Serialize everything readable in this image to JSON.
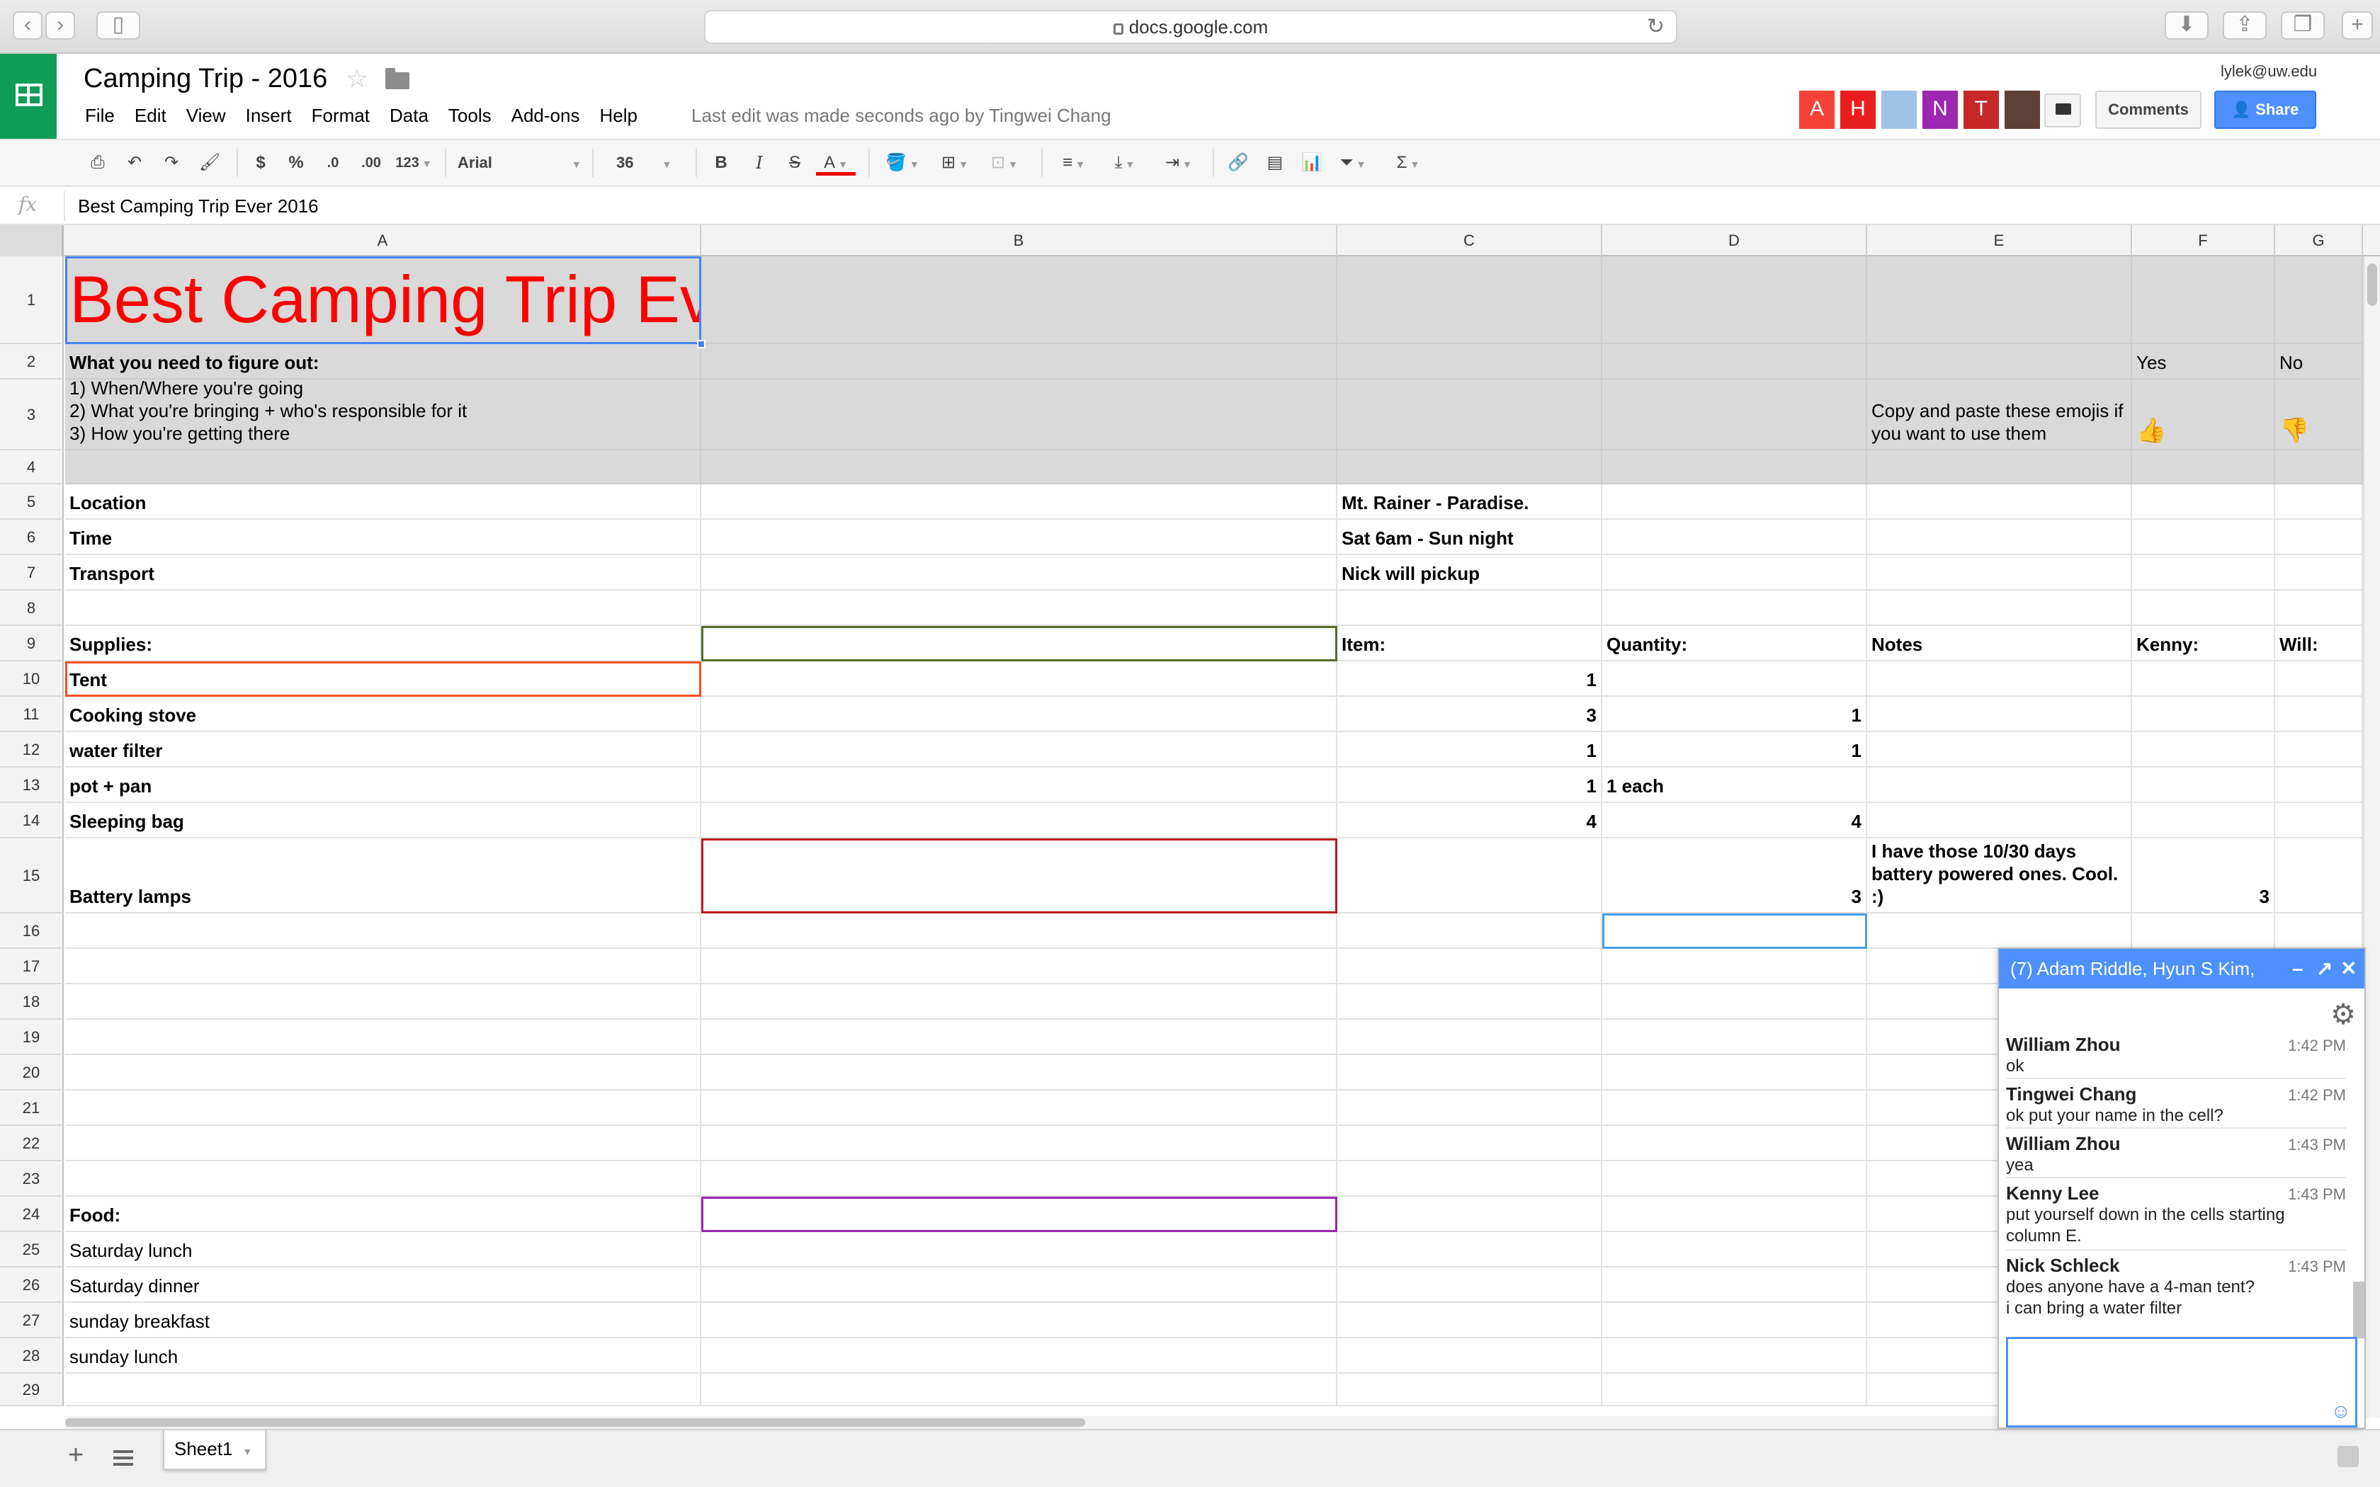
{
  "browser": {
    "url": "docs.google.com"
  },
  "doc": {
    "title": "Camping Trip - 2016",
    "menus": [
      "File",
      "Edit",
      "View",
      "Insert",
      "Format",
      "Data",
      "Tools",
      "Add-ons",
      "Help"
    ],
    "last_edit": "Last edit was made seconds ago by Tingwei Chang",
    "user_email": "lylek@uw.edu",
    "collaborators": [
      {
        "letter": "A",
        "color": "#f44336"
      },
      {
        "letter": "H",
        "color": "#e91e1e"
      },
      {
        "letter": "",
        "color": "#9ec3e6"
      },
      {
        "letter": "N",
        "color": "#9c27b0"
      },
      {
        "letter": "T",
        "color": "#c62828"
      },
      {
        "letter": "",
        "color": "#5d4037"
      }
    ],
    "comments_label": "Comments",
    "share_label": "Share"
  },
  "toolbar": {
    "currency": "$",
    "percent": "%",
    "dec_less": ".0",
    "dec_more": ".00",
    "format": "123",
    "font": "Arial",
    "size": "36",
    "bold": "B",
    "italic": "I",
    "strike": "S",
    "text_color": "A",
    "sum": "Σ"
  },
  "formula": {
    "fx": "fx",
    "value": "Best Camping Trip Ever 2016"
  },
  "columns": [
    "A",
    "B",
    "C",
    "D",
    "E",
    "F",
    "G"
  ],
  "rows": [
    "1",
    "2",
    "3",
    "4",
    "5",
    "6",
    "7",
    "8",
    "9",
    "10",
    "11",
    "12",
    "13",
    "14",
    "15",
    "16",
    "17",
    "18",
    "19",
    "20",
    "21",
    "22",
    "23",
    "24",
    "25",
    "26",
    "27",
    "28",
    "29"
  ],
  "cells": {
    "A1": "Best Camping Trip Ever 2016",
    "A2": "What you need to figure out:",
    "F2": "Yes",
    "G2": "No",
    "A3": "1) When/Where you're going\n2) What you're bringing + who's responsible for it\n3) How you're getting there",
    "E3": "Copy and paste these emojis if\nyou want to use them",
    "F3": "👍",
    "G3": "👎",
    "A5": "Location",
    "C5": "Mt. Rainer - Paradise.",
    "A6": "Time",
    "C6": "Sat 6am - Sun night",
    "A7": "Transport",
    "C7": "Nick will pickup",
    "A9": "Supplies:",
    "C9": "Item:",
    "D9": "Quantity:",
    "E9": "Notes",
    "F9": "Kenny:",
    "G9": "Will:",
    "A10": "Tent",
    "C10": "1",
    "A11": "Cooking stove",
    "C11": "3",
    "D11": "1",
    "A12": "water filter",
    "C12": "1",
    "D12": "1",
    "A13": "pot + pan",
    "C13": "1",
    "D13": "1 each",
    "A14": "Sleeping bag",
    "C14": "4",
    "D14": "4",
    "A15": "Battery lamps",
    "D15": "3",
    "E15": "I have those 10/30 days\nbattery powered ones.  Cool.\n:)",
    "F15": "3",
    "A24": "Food:",
    "A25": "Saturday lunch",
    "A26": "Saturday dinner",
    "A27": "sunday breakfast",
    "A28": "sunday lunch"
  },
  "sheet_tab": "Sheet1",
  "chat": {
    "title": "(7) Adam Riddle, Hyun S Kim,",
    "messages": [
      {
        "who": "William Zhou",
        "time": "1:42 PM",
        "text": "ok"
      },
      {
        "who": "Tingwei Chang",
        "time": "1:42 PM",
        "text": "ok put your name in the cell?"
      },
      {
        "who": "William Zhou",
        "time": "1:43 PM",
        "text": "yea"
      },
      {
        "who": "Kenny Lee",
        "time": "1:43 PM",
        "text": "put yourself down in the cells starting\ncolumn E."
      },
      {
        "who": "Nick Schleck",
        "time": "1:43 PM",
        "text": "does anyone have a 4-man tent?\ni can bring a water filter"
      }
    ]
  },
  "colors": {
    "title_red": "#ff0000",
    "share_blue": "#4d90fe",
    "sheets_green": "#0f9d58"
  }
}
